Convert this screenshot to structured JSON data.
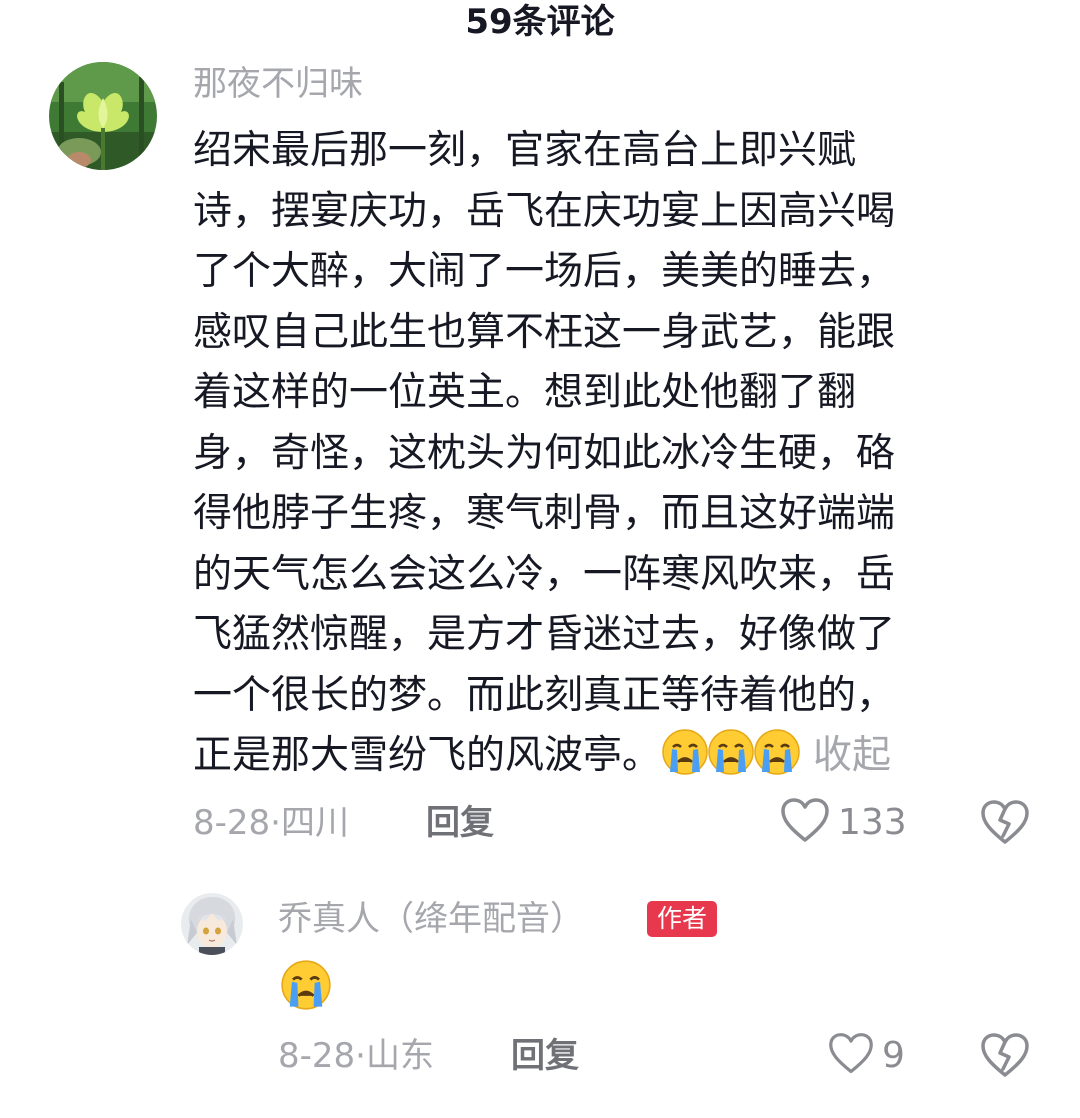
{
  "header": {
    "title": "59条评论"
  },
  "comments": [
    {
      "username": "那夜不归味",
      "lines": [
        "绍宋最后那一刻，官家在高台上即兴赋",
        "诗，摆宴庆功，岳飞在庆功宴上因高兴喝",
        "了个大醉，大闹了一场后，美美的睡去，",
        "感叹自己此生也算不枉这一身武艺，能跟",
        "着这样的一位英主。想到此处他翻了翻",
        "身，奇怪，这枕头为何如此冰冷生硬，硌",
        "得他脖子生疼，寒气刺骨，而且这好端端",
        "的天气怎么会这么冷，一阵寒风吹来，岳",
        "飞猛然惊醒，是方才昏迷过去，好像做了",
        "一个很长的梦。而此刻真正等待着他的，",
        "正是那大雪纷飞的风波亭。"
      ],
      "trailing_emojis": [
        "loudly-crying-face",
        "loudly-crying-face",
        "loudly-crying-face"
      ],
      "collapse_label": "收起",
      "date_location": "8-28·四川",
      "reply_label": "回复",
      "like_count": "133"
    },
    {
      "username": "乔真人（绛年配音）",
      "badge": "作者",
      "emoji": "loudly-crying-face",
      "date_location": "8-28·山东",
      "reply_label": "回复",
      "like_count": "9"
    }
  ],
  "colors": {
    "primary_text": "#161823",
    "secondary_text": "#a5a7ad",
    "reply_text": "#6f7177",
    "badge_bg": "#e8384d",
    "emoji_yellow": "#ffcc33",
    "emoji_tear": "#4a9ff5"
  }
}
